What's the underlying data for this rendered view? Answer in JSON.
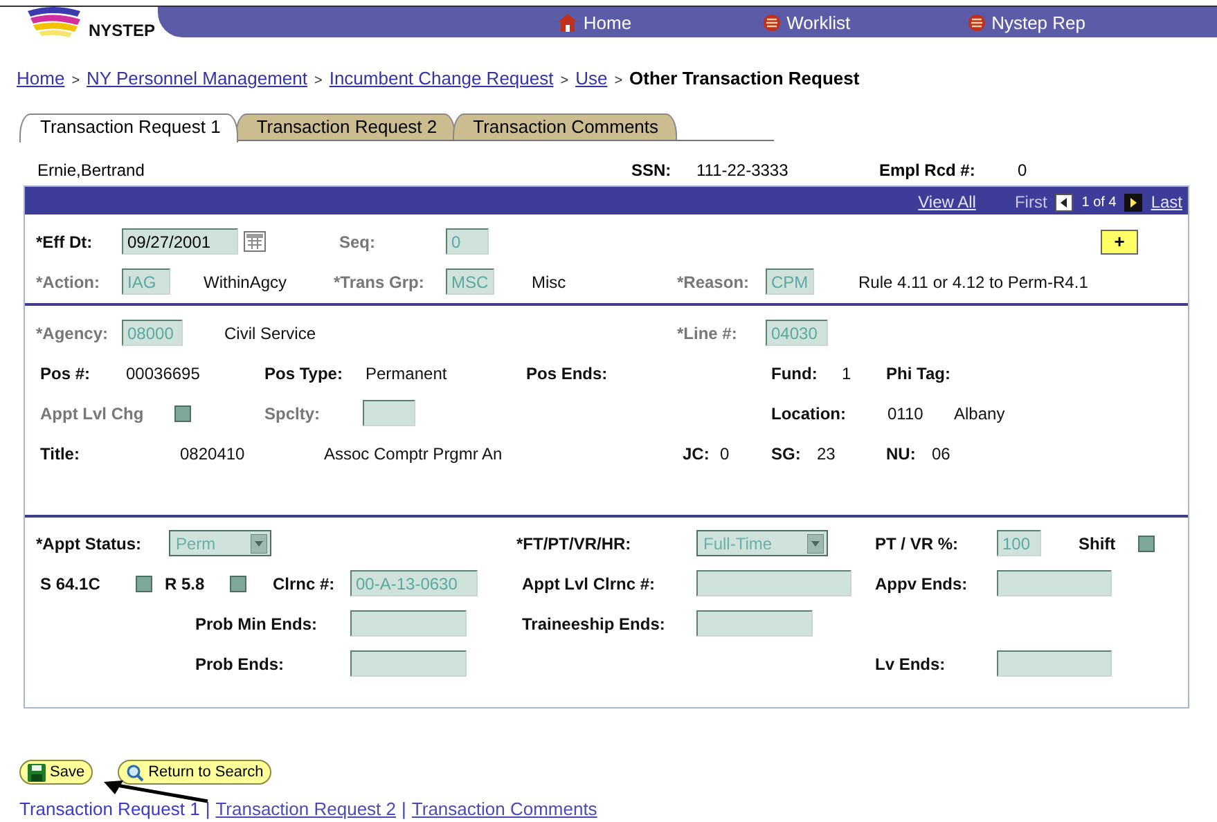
{
  "header": {
    "logo": "NYSTEP",
    "nav": [
      "Home",
      "Worklist",
      "Nystep Rep"
    ]
  },
  "breadcrumb": {
    "separator": ">",
    "links": [
      "Home",
      "NY Personnel Management",
      "Incumbent Change Request",
      "Use"
    ],
    "current": "Other Transaction Request"
  },
  "tabs": [
    {
      "label": "Transaction Request 1",
      "selected": true
    },
    {
      "label": "Transaction Request 2",
      "selected": false
    },
    {
      "label": "Transaction Comments",
      "selected": false
    }
  ],
  "employee": {
    "name": "Ernie,Bertrand",
    "ssn_label": "SSN:",
    "ssn": "111-22-3333",
    "empl_rcd_label": "Empl Rcd #:",
    "empl_rcd": "0"
  },
  "pager": {
    "view_all": "View All",
    "first": "First",
    "position": "1 of 4",
    "last": "Last"
  },
  "sections": [
    {
      "rows": [
        [
          {
            "kind": "label",
            "text": "*Eff Dt:",
            "disabled": false
          },
          {
            "kind": "field",
            "value": "09/27/2001",
            "disabled": false
          },
          {
            "kind": "calendar"
          },
          {
            "kind": "label",
            "text": "Seq:",
            "disabled": true
          },
          {
            "kind": "field",
            "value": "0",
            "disabled": true
          },
          {
            "kind": "add",
            "text": "+"
          }
        ],
        [
          {
            "kind": "label",
            "text": "*Action:",
            "disabled": true
          },
          {
            "kind": "field",
            "value": "IAG",
            "disabled": true
          },
          {
            "kind": "text",
            "text": "WithinAgcy"
          },
          {
            "kind": "label",
            "text": "*Trans Grp:",
            "disabled": true
          },
          {
            "kind": "field",
            "value": "MSC",
            "disabled": true
          },
          {
            "kind": "text",
            "text": "Misc"
          },
          {
            "kind": "label",
            "text": "*Reason:",
            "disabled": true
          },
          {
            "kind": "field",
            "value": "CPM",
            "disabled": true
          },
          {
            "kind": "text",
            "text": "Rule 4.11 or 4.12 to Perm-R4.1"
          }
        ]
      ]
    },
    {
      "rows": [
        [
          {
            "kind": "label",
            "text": "*Agency:",
            "disabled": true
          },
          {
            "kind": "field",
            "value": "08000",
            "disabled": true
          },
          {
            "kind": "text",
            "text": "Civil Service"
          },
          {
            "kind": "label",
            "text": "*Line #:",
            "disabled": true
          },
          "",
          {
            "kind": "field",
            "value": "04030",
            "disabled": true
          }
        ],
        [
          {
            "kind": "label",
            "text": "Pos #:",
            "disabled": false
          },
          {
            "kind": "text",
            "text": "00036695"
          },
          {
            "kind": "label",
            "text": "Pos Type:",
            "disabled": false
          },
          {
            "kind": "text",
            "text": "Permanent"
          },
          {
            "kind": "label",
            "text": "Pos Ends:",
            "disabled": false
          },
          {
            "kind": "label",
            "text": "Fund:",
            "disabled": false
          },
          {
            "kind": "text",
            "text": "1"
          },
          {
            "kind": "label",
            "text": "Phi Tag:",
            "disabled": false
          }
        ],
        [
          {
            "kind": "label",
            "text": "Appt Lvl Chg",
            "disabled": true
          },
          {
            "kind": "checkbox",
            "checked": false
          },
          {
            "kind": "label",
            "text": "Spclty:",
            "disabled": true
          },
          {
            "kind": "field"
          },
          "",
          {
            "kind": "label",
            "text": "Location:",
            "disabled": false
          },
          "",
          {
            "kind": "text",
            "text": "0110"
          },
          {
            "kind": "text",
            "text": "Albany"
          }
        ],
        [
          {
            "kind": "label",
            "text": "Title:",
            "disabled": false
          },
          {
            "kind": "text",
            "text": "0820410"
          },
          {
            "kind": "text",
            "text": "Assoc Comptr Prgmr An"
          },
          {
            "kind": "label",
            "text": "JC:",
            "disabled": false
          },
          {
            "kind": "text",
            "text": "0"
          },
          {
            "kind": "label",
            "text": "SG:",
            "disabled": false
          },
          {
            "kind": "text",
            "text": "23"
          },
          {
            "kind": "label",
            "text": "NU:",
            "disabled": false
          },
          {
            "kind": "text",
            "text": "06"
          }
        ]
      ]
    },
    {
      "rows": [
        [
          {
            "kind": "label",
            "text": "*Appt Status:",
            "disabled": false
          },
          "",
          {
            "kind": "select",
            "value": "Perm",
            "disabled": true
          },
          "",
          "",
          "",
          {
            "kind": "label",
            "text": "*FT/PT/VR/HR:",
            "disabled": false
          },
          {
            "kind": "select",
            "value": "Full-Time",
            "disabled": true
          },
          {
            "kind": "label",
            "text": "PT / VR %:",
            "disabled": false
          },
          {
            "kind": "field",
            "value": "100",
            "disabled": true
          },
          {
            "kind": "label",
            "text": "Shift",
            "disabled": false
          },
          {
            "kind": "checkbox",
            "checked": false
          }
        ],
        [
          {
            "kind": "label",
            "text": "S 64.1C",
            "disabled": false
          },
          {
            "kind": "checkbox",
            "checked": false
          },
          {
            "kind": "label",
            "text": "R 5.8",
            "disabled": false
          },
          {
            "kind": "checkbox",
            "checked": false
          },
          {
            "kind": "label",
            "text": "Clrnc #:",
            "disabled": false
          },
          {
            "kind": "field",
            "value": "00-A-13-0630",
            "disabled": true
          },
          {
            "kind": "label",
            "text": "Appt Lvl Clrnc #:",
            "disabled": false
          },
          {
            "kind": "field"
          },
          {
            "kind": "label",
            "text": "Appv Ends:",
            "disabled": false
          },
          {
            "kind": "field"
          }
        ],
        [
          "",
          "",
          {
            "kind": "label",
            "text": "Prob Min Ends:",
            "disabled": false
          },
          "",
          "",
          {
            "kind": "field"
          },
          {
            "kind": "label",
            "text": "Traineeship Ends:",
            "disabled": false
          },
          {
            "kind": "field"
          }
        ],
        [
          "",
          "",
          {
            "kind": "label",
            "text": "Prob Ends:",
            "disabled": false
          },
          "",
          "",
          {
            "kind": "field"
          },
          "",
          "",
          {
            "kind": "label",
            "text": "Lv Ends:",
            "disabled": false
          },
          {
            "kind": "field"
          }
        ]
      ]
    }
  ],
  "buttons": [
    {
      "kind": "save",
      "label": "Save"
    },
    {
      "kind": "search",
      "label": "Return to Search"
    }
  ],
  "footer": {
    "separator": "|",
    "links": [
      {
        "label": "Transaction Request 1",
        "selected": true
      },
      {
        "label": "Transaction Request 2",
        "selected": false
      },
      {
        "label": "Transaction Comments",
        "selected": false
      }
    ]
  }
}
